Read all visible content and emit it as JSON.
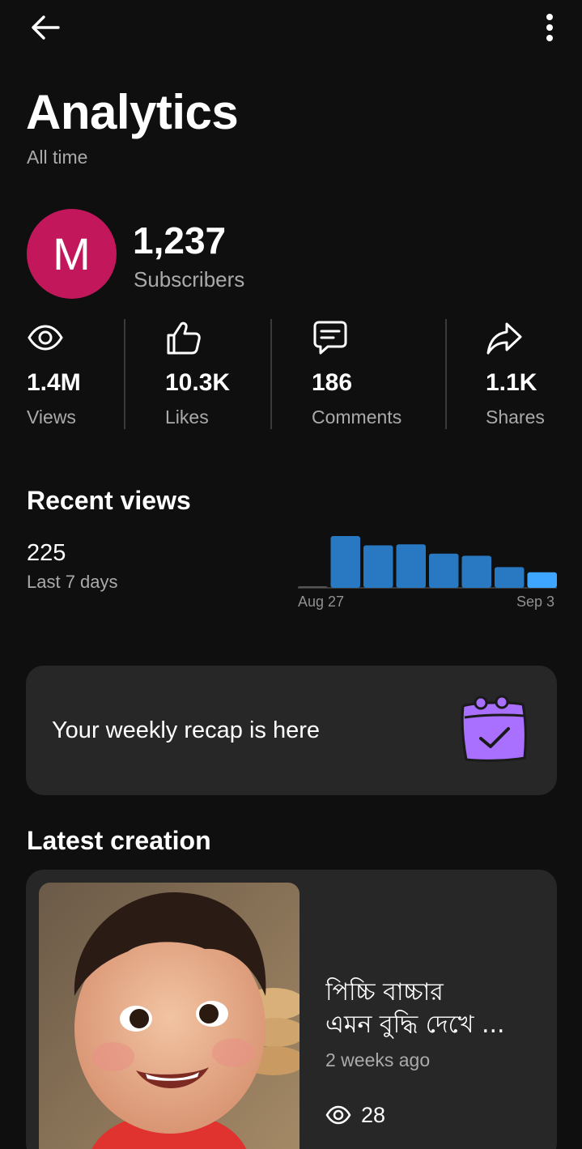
{
  "header": {
    "back_icon": "arrow-left-icon",
    "more_icon": "more-vertical-icon"
  },
  "page": {
    "title": "Analytics",
    "subtitle": "All time"
  },
  "channel": {
    "avatar_letter": "M",
    "avatar_color": "#c2185b",
    "subscribers": "1,237",
    "subscribers_label": "Subscribers"
  },
  "stats": [
    {
      "icon": "eye-icon",
      "value": "1.4M",
      "label": "Views"
    },
    {
      "icon": "thumbs-up-icon",
      "value": "10.3K",
      "label": "Likes"
    },
    {
      "icon": "comment-icon",
      "value": "186",
      "label": "Comments"
    },
    {
      "icon": "share-icon",
      "value": "1.1K",
      "label": "Shares"
    }
  ],
  "recent_views": {
    "title": "Recent views",
    "value": "225",
    "period": "Last 7 days"
  },
  "chart_data": {
    "type": "bar",
    "categories": [
      "Aug 27",
      "Aug 28",
      "Aug 29",
      "Aug 30",
      "Aug 31",
      "Sep 1",
      "Sep 2",
      "Sep 3"
    ],
    "values": [
      1,
      50,
      41,
      42,
      33,
      31,
      20,
      15
    ],
    "x_tick_labels": [
      "Aug 27",
      "Sep 3"
    ],
    "bar_color": "#2979c2",
    "last_bar_color": "#3ea6ff",
    "grid": false
  },
  "recap": {
    "text": "Your weekly recap is here",
    "icon": "calendar-check-icon",
    "icon_color": "#a970ff"
  },
  "latest": {
    "title": "Latest creation",
    "video_title_line1": "পিচ্চি বাচ্চার",
    "video_title_line2": "এমন বুদ্ধি দেখে ...",
    "age": "2 weeks ago",
    "views": "28",
    "views_icon": "eye-icon"
  }
}
